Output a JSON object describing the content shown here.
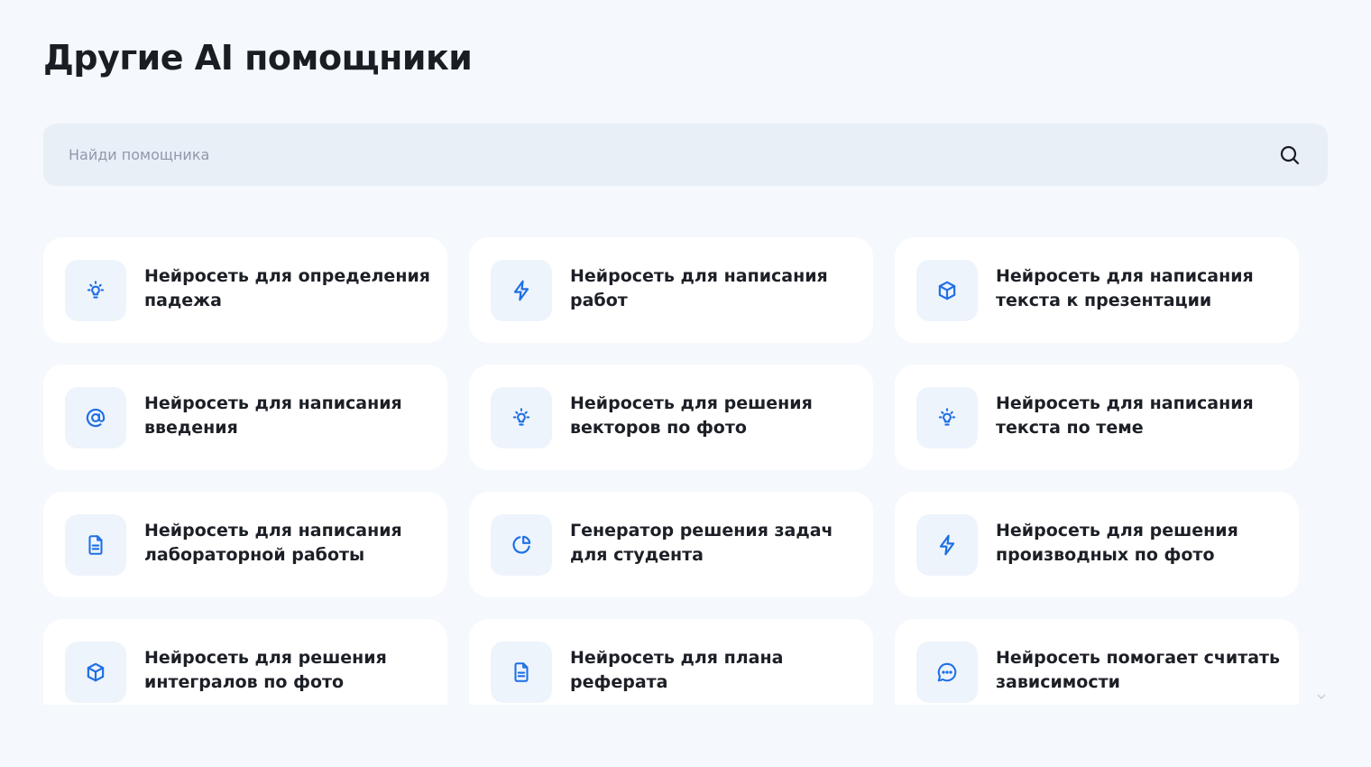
{
  "page": {
    "title": "Другие AI помощники"
  },
  "search": {
    "placeholder": "Найди помощника",
    "value": "",
    "icon": "search-icon"
  },
  "colors": {
    "accent": "#1f6fe5",
    "icon_bg": "#eef4fc",
    "card_bg": "#ffffff",
    "page_bg": "#f5f8fc",
    "search_bg": "#e9eff7"
  },
  "assistants": [
    {
      "icon": "lightbulb-icon",
      "label": "Нейросеть для определения падежа"
    },
    {
      "icon": "lightning-icon",
      "label": "Нейросеть для написания работ"
    },
    {
      "icon": "cube-icon",
      "label": "Нейросеть для написания текста к презентации"
    },
    {
      "icon": "at-sign-icon",
      "label": "Нейросеть для написания введения"
    },
    {
      "icon": "lightbulb-icon",
      "label": "Нейросеть для решения векторов по фото"
    },
    {
      "icon": "lightbulb-icon",
      "label": "Нейросеть для написания текста по теме"
    },
    {
      "icon": "document-icon",
      "label": "Нейросеть для написания лабораторной работы"
    },
    {
      "icon": "pie-chart-icon",
      "label": "Генератор решения задач для студента"
    },
    {
      "icon": "lightning-icon",
      "label": "Нейросеть для решения производных по фото"
    },
    {
      "icon": "cube-icon",
      "label": "Нейросеть для решения интегралов по фото"
    },
    {
      "icon": "document-icon",
      "label": "Нейросеть для плана реферата"
    },
    {
      "icon": "chat-bubble-icon",
      "label": "Нейросеть помогает считать зависимости"
    }
  ]
}
